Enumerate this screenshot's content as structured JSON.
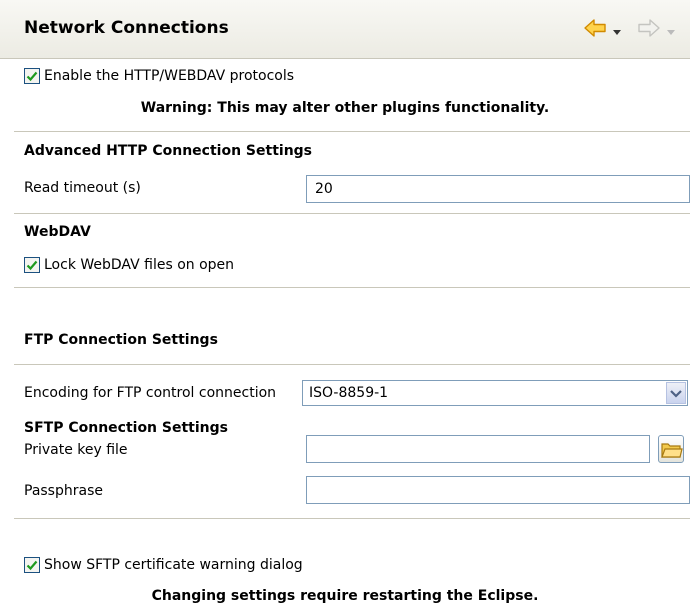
{
  "header": {
    "title": "Network Connections"
  },
  "http": {
    "enable_label": "Enable the HTTP/WEBDAV protocols",
    "enable_checked": true,
    "warning": "Warning: This may alter other plugins functionality."
  },
  "advanced_http": {
    "title": "Advanced HTTP Connection Settings",
    "read_timeout_label": "Read timeout (s)",
    "read_timeout_value": "20"
  },
  "webdav": {
    "title": "WebDAV",
    "lock_label": "Lock WebDAV files on open",
    "lock_checked": true
  },
  "ftp": {
    "title": "FTP Connection Settings",
    "encoding_label": "Encoding for FTP control connection",
    "encoding_value": "ISO-8859-1"
  },
  "sftp": {
    "title": "SFTP Connection Settings",
    "private_key_label": "Private key file",
    "private_key_value": "",
    "passphrase_label": "Passphrase",
    "passphrase_value": "",
    "show_warning_label": "Show SFTP certificate warning dialog",
    "show_warning_checked": true
  },
  "footer": {
    "note": "Changing settings require restarting the Eclipse."
  },
  "icons": {
    "back": "arrow-left-icon",
    "forward": "arrow-right-icon",
    "dropdown": "chevron-down-icon",
    "folder": "folder-icon",
    "check": "checkmark-icon"
  },
  "colors": {
    "header_bg": "#ecebe3",
    "back_arrow": "#f5a623",
    "check_mark": "#1e9a1e",
    "border": "#7f9db9"
  }
}
